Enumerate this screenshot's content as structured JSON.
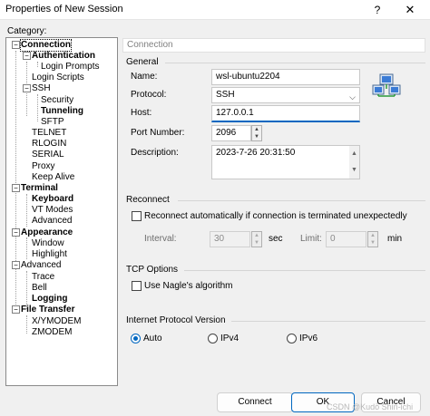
{
  "window": {
    "title": "Properties of New Session",
    "help_glyph": "?",
    "close_glyph": "✕"
  },
  "category_label": "Category:",
  "tree": {
    "items": [
      {
        "label": "Connection",
        "bold": true
      },
      {
        "label": "Authentication",
        "bold": true
      },
      {
        "label": "Login Prompts",
        "bold": false
      },
      {
        "label": "Login Scripts",
        "bold": false
      },
      {
        "label": "SSH",
        "bold": false
      },
      {
        "label": "Security",
        "bold": false
      },
      {
        "label": "Tunneling",
        "bold": true
      },
      {
        "label": "SFTP",
        "bold": false
      },
      {
        "label": "TELNET",
        "bold": false
      },
      {
        "label": "RLOGIN",
        "bold": false
      },
      {
        "label": "SERIAL",
        "bold": false
      },
      {
        "label": "Proxy",
        "bold": false
      },
      {
        "label": "Keep Alive",
        "bold": false
      },
      {
        "label": "Terminal",
        "bold": true
      },
      {
        "label": "Keyboard",
        "bold": true
      },
      {
        "label": "VT Modes",
        "bold": false
      },
      {
        "label": "Advanced",
        "bold": false
      },
      {
        "label": "Appearance",
        "bold": true
      },
      {
        "label": "Window",
        "bold": false
      },
      {
        "label": "Highlight",
        "bold": false
      },
      {
        "label": "Advanced",
        "bold": false
      },
      {
        "label": "Trace",
        "bold": false
      },
      {
        "label": "Bell",
        "bold": false
      },
      {
        "label": "Logging",
        "bold": true
      },
      {
        "label": "File Transfer",
        "bold": true
      },
      {
        "label": "X/YMODEM",
        "bold": false
      },
      {
        "label": "ZMODEM",
        "bold": false
      }
    ],
    "expander_glyph": "−"
  },
  "panel_header": "Connection",
  "general": {
    "title": "General",
    "name_label": "Name:",
    "name_value": "wsl-ubuntu2204",
    "protocol_label": "Protocol:",
    "protocol_value": "SSH",
    "host_label": "Host:",
    "host_value": "127.0.0.1",
    "port_label": "Port Number:",
    "port_value": "2096",
    "description_label": "Description:",
    "description_value": "2023-7-26 20:31:50"
  },
  "reconnect": {
    "title": "Reconnect",
    "auto_label": "Reconnect automatically if connection is terminated unexpectedly",
    "auto_checked": false,
    "interval_label": "Interval:",
    "interval_value": "30",
    "interval_unit": "sec",
    "limit_label": "Limit:",
    "limit_value": "0",
    "limit_unit": "min"
  },
  "tcp": {
    "title": "TCP Options",
    "nagle_label": "Use Nagle's algorithm",
    "nagle_checked": false
  },
  "ip": {
    "title": "Internet Protocol Version",
    "options": [
      "Auto",
      "IPv4",
      "IPv6"
    ],
    "selected": "Auto"
  },
  "buttons": {
    "connect": "Connect",
    "ok": "OK",
    "cancel": "Cancel"
  },
  "watermark": "CSDN @Kudō Shin-ichi",
  "glyphs": {
    "combo_arrow": "⌵",
    "spin_up": "▲",
    "spin_down": "▼"
  },
  "colors": {
    "accent": "#0067c0"
  },
  "icons": {
    "network": "network-computers-icon"
  }
}
